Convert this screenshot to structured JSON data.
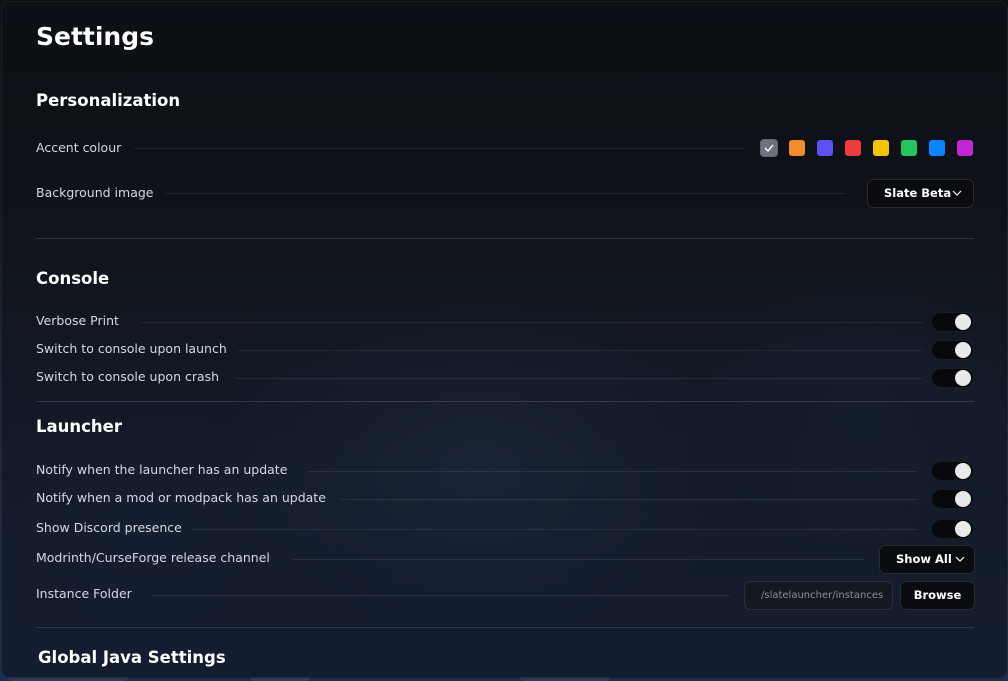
{
  "page": {
    "title": "Settings"
  },
  "personalization": {
    "title": "Personalization",
    "accent_label": "Accent colour",
    "accent_colors": [
      "#6b7280",
      "#f28c28",
      "#5b4ff5",
      "#ef3b3b",
      "#f5c400",
      "#22c55e",
      "#0a84ff",
      "#c026d3"
    ],
    "accent_selected_index": 0,
    "background_label": "Background image",
    "background_value": "Slate Beta"
  },
  "console": {
    "title": "Console",
    "items": [
      {
        "label": "Verbose Print",
        "on": true
      },
      {
        "label": "Switch to console upon launch",
        "on": true
      },
      {
        "label": "Switch to console upon crash",
        "on": true
      }
    ]
  },
  "launcher": {
    "title": "Launcher",
    "toggles": [
      {
        "label": "Notify when the launcher has an update",
        "on": true
      },
      {
        "label": "Notify when a mod or modpack has an update",
        "on": true
      },
      {
        "label": "Show Discord presence",
        "on": true
      }
    ],
    "release_channel_label": "Modrinth/CurseForge release channel",
    "release_channel_value": "Show All",
    "instance_folder_label": "Instance Folder",
    "instance_folder_path": "/slatelauncher/instances",
    "browse_label": "Browse"
  },
  "java": {
    "title": "Global Java Settings"
  }
}
